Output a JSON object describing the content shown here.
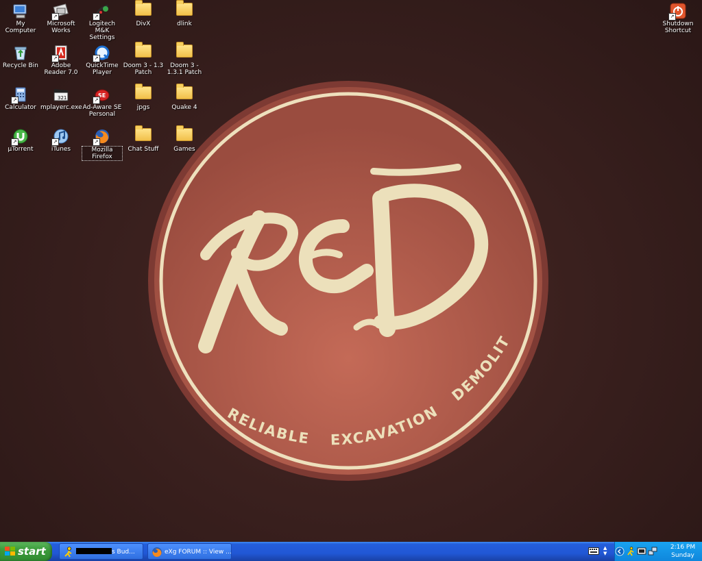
{
  "desktop": {
    "icons": [
      {
        "label": "My Computer",
        "icon": "my-computer-icon"
      },
      {
        "label": "Microsoft Works",
        "icon": "microsoft-works-icon"
      },
      {
        "label": "Logitech M&K Settings",
        "icon": "logitech-icon"
      },
      {
        "label": "DivX",
        "icon": "folder-icon"
      },
      {
        "label": "dlink",
        "icon": "folder-icon"
      },
      {
        "label": "Recycle Bin",
        "icon": "recycle-bin-icon"
      },
      {
        "label": "Adobe Reader 7.0",
        "icon": "adobe-reader-icon"
      },
      {
        "label": "QuickTime Player",
        "icon": "quicktime-icon"
      },
      {
        "label": "Doom 3 - 1.3 Patch",
        "icon": "folder-icon"
      },
      {
        "label": "Doom 3 - 1.3.1 Patch",
        "icon": "folder-icon"
      },
      {
        "label": "Calculator",
        "icon": "calculator-icon"
      },
      {
        "label": "mplayerc.exe",
        "icon": "media-player-icon"
      },
      {
        "label": "Ad-Aware SE Personal",
        "icon": "ad-aware-icon"
      },
      {
        "label": "jpgs",
        "icon": "folder-icon"
      },
      {
        "label": "Quake 4",
        "icon": "folder-icon"
      },
      {
        "label": "µTorrent",
        "icon": "utorrent-icon"
      },
      {
        "label": "iTunes",
        "icon": "itunes-icon"
      },
      {
        "label": "Mozilla Firefox",
        "icon": "firefox-icon"
      },
      {
        "label": "Chat Stuff",
        "icon": "folder-icon"
      },
      {
        "label": "Games",
        "icon": "folder-icon"
      }
    ],
    "shutdown": {
      "label": "Shutdown Shortcut",
      "icon": "shutdown-icon"
    }
  },
  "wallpaper": {
    "logo_text": "RED",
    "tagline_words": [
      "RELIABLE",
      "EXCAVATION",
      "DEMOLITION"
    ],
    "colors": {
      "disc": "#b55e4e",
      "ring": "#eee0bd",
      "text": "#ece0bb"
    }
  },
  "taskbar": {
    "start_label": "start",
    "tasks": [
      {
        "suffix": "s Bud...",
        "icon": "buddy-list-icon"
      },
      {
        "label": "eXg FORUM :: View ...",
        "icon": "firefox-icon"
      }
    ],
    "clock": {
      "time": "2:16 PM",
      "day": "Sunday"
    }
  }
}
